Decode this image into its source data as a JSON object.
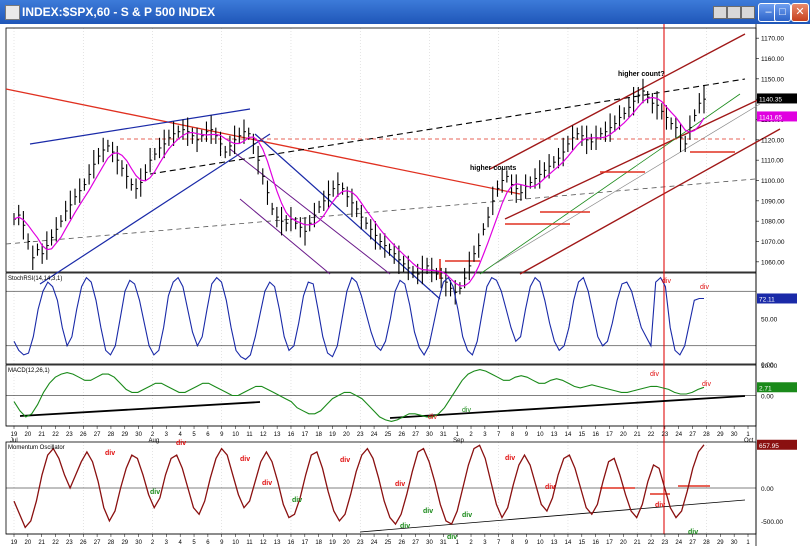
{
  "window": {
    "title": "INDEX:$SPX,60  -  S & P 500 INDEX"
  },
  "colors": {
    "background": "#ffffff",
    "price_bars": "#000000",
    "moving_average": "#e000e0",
    "trend_red": "#e03020",
    "channel_blue": "#1a2aa8",
    "channel_darkred": "#a01818",
    "stoch_line": "#1a2aa8",
    "macd_line": "#1a8a1a",
    "osc_line": "#8a1010",
    "div_red": "#e01010",
    "div_green": "#1a8a1a"
  },
  "chart_data": [
    {
      "type": "line",
      "panel": "price",
      "title": "INDEX:$SPX,60",
      "ylim": [
        1055,
        1175
      ],
      "y_ticks": [
        "1170.00",
        "1160.00",
        "1150.00",
        "1140.00",
        "1130.00",
        "1120.00",
        "1110.00",
        "1100.00",
        "1090.00",
        "1080.00",
        "1070.00",
        "1060.00"
      ],
      "last_value_label": "1140.35",
      "ma_value_label": "1141.65",
      "series": [
        {
          "values": [
            1081,
            1083,
            1078,
            1070,
            1062,
            1066,
            1064,
            1068,
            1072,
            1076,
            1080,
            1085,
            1088,
            1092,
            1095,
            1098,
            1103,
            1108,
            1112,
            1115,
            1117,
            1114,
            1110,
            1106,
            1102,
            1098,
            1096,
            1099,
            1104,
            1110,
            1113,
            1116,
            1118,
            1121,
            1123,
            1124,
            1125,
            1124,
            1122,
            1120,
            1122,
            1124,
            1125,
            1122,
            1118,
            1114,
            1117,
            1120,
            1122,
            1124,
            1123,
            1118,
            1110,
            1102,
            1094,
            1086,
            1082,
            1080,
            1079,
            1081,
            1079,
            1077,
            1075,
            1079,
            1083,
            1087,
            1090,
            1093,
            1096,
            1098,
            1096,
            1092,
            1089,
            1086,
            1082,
            1079,
            1076,
            1073,
            1070,
            1068,
            1066,
            1064,
            1061,
            1059,
            1057,
            1055,
            1054,
            1056,
            1058,
            1056,
            1054,
            1052,
            1050,
            1047,
            1045,
            1047,
            1052,
            1058,
            1064,
            1068,
            1076,
            1082,
            1090,
            1096,
            1100,
            1102,
            1098,
            1096,
            1094,
            1097,
            1099,
            1101,
            1103,
            1105,
            1107,
            1109,
            1111,
            1114,
            1118,
            1121,
            1123,
            1122,
            1120,
            1119,
            1121,
            1123,
            1124,
            1126,
            1128,
            1131,
            1133,
            1136,
            1139,
            1142,
            1144,
            1141,
            1138,
            1137,
            1134,
            1131,
            1128,
            1126,
            1121,
            1118,
            1126,
            1132,
            1138,
            1140
          ]
        }
      ],
      "annotations": [
        "higher counts",
        "higher count?"
      ]
    },
    {
      "type": "line",
      "panel": "stochastic",
      "title": "StochRSI(14,14,3,1)",
      "ylim": [
        0,
        100
      ],
      "y_ticks": [
        "50.00",
        "0.00"
      ],
      "last_value_label": "72.11",
      "series": [
        {
          "values": [
            25,
            15,
            10,
            12,
            30,
            60,
            80,
            90,
            85,
            70,
            40,
            20,
            30,
            60,
            85,
            95,
            90,
            70,
            40,
            15,
            10,
            20,
            50,
            80,
            92,
            88,
            70,
            45,
            20,
            10,
            15,
            40,
            75,
            90,
            95,
            85,
            60,
            35,
            20,
            30,
            60,
            88,
            95,
            90,
            70,
            40,
            15,
            8,
            5,
            10,
            30,
            55,
            80,
            90,
            85,
            60,
            30,
            15,
            20,
            45,
            75,
            90,
            88,
            60,
            30,
            12,
            8,
            20,
            50,
            80,
            95,
            90,
            75,
            55,
            35,
            20,
            15,
            25,
            50,
            80,
            92,
            88,
            65,
            35,
            18,
            10,
            20,
            45,
            70,
            90,
            95,
            85,
            60,
            30,
            15,
            10,
            25,
            55,
            85,
            95,
            92,
            80,
            60,
            40,
            25,
            30,
            60,
            85,
            95,
            90,
            70,
            45,
            25,
            15,
            20,
            40,
            70,
            90,
            95,
            80,
            55,
            30,
            20,
            25,
            45,
            70,
            88,
            90,
            80,
            60,
            40,
            30,
            20,
            90,
            95,
            85,
            40,
            15,
            10,
            20,
            45,
            70,
            72,
            72
          ]
        }
      ],
      "annotations": [
        "div",
        "div"
      ]
    },
    {
      "type": "line",
      "panel": "macd",
      "title": "MACD(12,26,1)",
      "ylim": [
        -10,
        10
      ],
      "y_ticks": [
        "10.00",
        "0.00"
      ],
      "last_value_label": "2.71",
      "series": [
        {
          "values": [
            -2,
            -5,
            -7,
            -6,
            -3,
            1,
            4,
            6,
            7,
            7.5,
            7,
            6,
            5,
            5,
            6,
            7,
            7,
            6,
            4,
            2,
            1,
            1,
            2,
            3,
            4,
            4,
            3,
            2,
            1,
            1,
            2,
            3,
            4,
            4,
            3,
            2,
            1,
            0,
            0,
            1,
            2,
            3,
            3,
            2,
            1,
            0,
            -1,
            -2,
            -4,
            -5,
            -6,
            -6,
            -5,
            -3,
            -1,
            0,
            1,
            1,
            0,
            -1,
            -3,
            -5,
            -7,
            -8,
            -8.5,
            -8,
            -7,
            -6,
            -6,
            -6.5,
            -7,
            -7,
            -6,
            -4,
            -1,
            2,
            5,
            7,
            8,
            8.5,
            8,
            7,
            6,
            5,
            5,
            6,
            6.5,
            6,
            5,
            4,
            4,
            5,
            5.5,
            5,
            4,
            3,
            2.5,
            3,
            3.5,
            3,
            2.5,
            2,
            1.5,
            1,
            1,
            1.5,
            2,
            2.5,
            3,
            3,
            2.5,
            2,
            1,
            0.5,
            0.5,
            1,
            2,
            2.7
          ]
        }
      ],
      "annotations": [
        "div",
        "div",
        "div",
        "div"
      ]
    },
    {
      "type": "line",
      "panel": "momentum",
      "title": "Momentum Oscillator",
      "ylim": [
        -700,
        700
      ],
      "y_ticks": [
        "0.00",
        "-500.00"
      ],
      "last_value_label": "657.95",
      "series": [
        {
          "values": [
            -200,
            -400,
            -600,
            -500,
            -200,
            200,
            500,
            600,
            450,
            200,
            0,
            200,
            400,
            550,
            400,
            100,
            -300,
            -500,
            -350,
            0,
            300,
            500,
            450,
            200,
            -100,
            -300,
            -150,
            200,
            450,
            500,
            300,
            0,
            -300,
            -400,
            -200,
            150,
            450,
            600,
            500,
            200,
            -100,
            -300,
            -200,
            100,
            400,
            550,
            400,
            100,
            -250,
            -450,
            -400,
            -150,
            200,
            500,
            550,
            300,
            -50,
            -350,
            -500,
            -400,
            -100,
            250,
            500,
            600,
            450,
            150,
            -200,
            -450,
            -550,
            -400,
            -100,
            250,
            550,
            600,
            400,
            100,
            -250,
            -500,
            -550,
            -350,
            0,
            350,
            600,
            650,
            450,
            100,
            -250,
            -450,
            -300,
            50,
            350,
            500,
            350,
            50,
            -250,
            -350,
            -150,
            200,
            450,
            500,
            300,
            0,
            -300,
            -400,
            -250,
            100,
            400,
            450,
            200,
            -100,
            -350,
            -450,
            -250,
            100,
            350,
            300,
            0,
            -300,
            -450,
            -350,
            -50,
            300,
            550,
            658
          ]
        }
      ],
      "annotations": [
        "div",
        "div",
        "div",
        "div",
        "div",
        "div",
        "div",
        "div",
        "div",
        "div",
        "div",
        "div",
        "div",
        "div",
        "div",
        "div"
      ]
    }
  ],
  "x_axis": {
    "day_ticks": [
      "19",
      "20",
      "21",
      "22",
      "23",
      "26",
      "27",
      "28",
      "29",
      "30",
      "2",
      "3",
      "4",
      "5",
      "6",
      "9",
      "10",
      "11",
      "12",
      "13",
      "16",
      "17",
      "18",
      "19",
      "20",
      "23",
      "24",
      "25",
      "26",
      "27",
      "30",
      "31",
      "1",
      "2",
      "3",
      "7",
      "8",
      "9",
      "10",
      "13",
      "14",
      "15",
      "16",
      "17",
      "20",
      "21",
      "22",
      "23",
      "24",
      "27",
      "28",
      "29",
      "30",
      "1"
    ],
    "month_labels": [
      "Jul",
      "Aug",
      "Sep",
      "Oct"
    ]
  }
}
